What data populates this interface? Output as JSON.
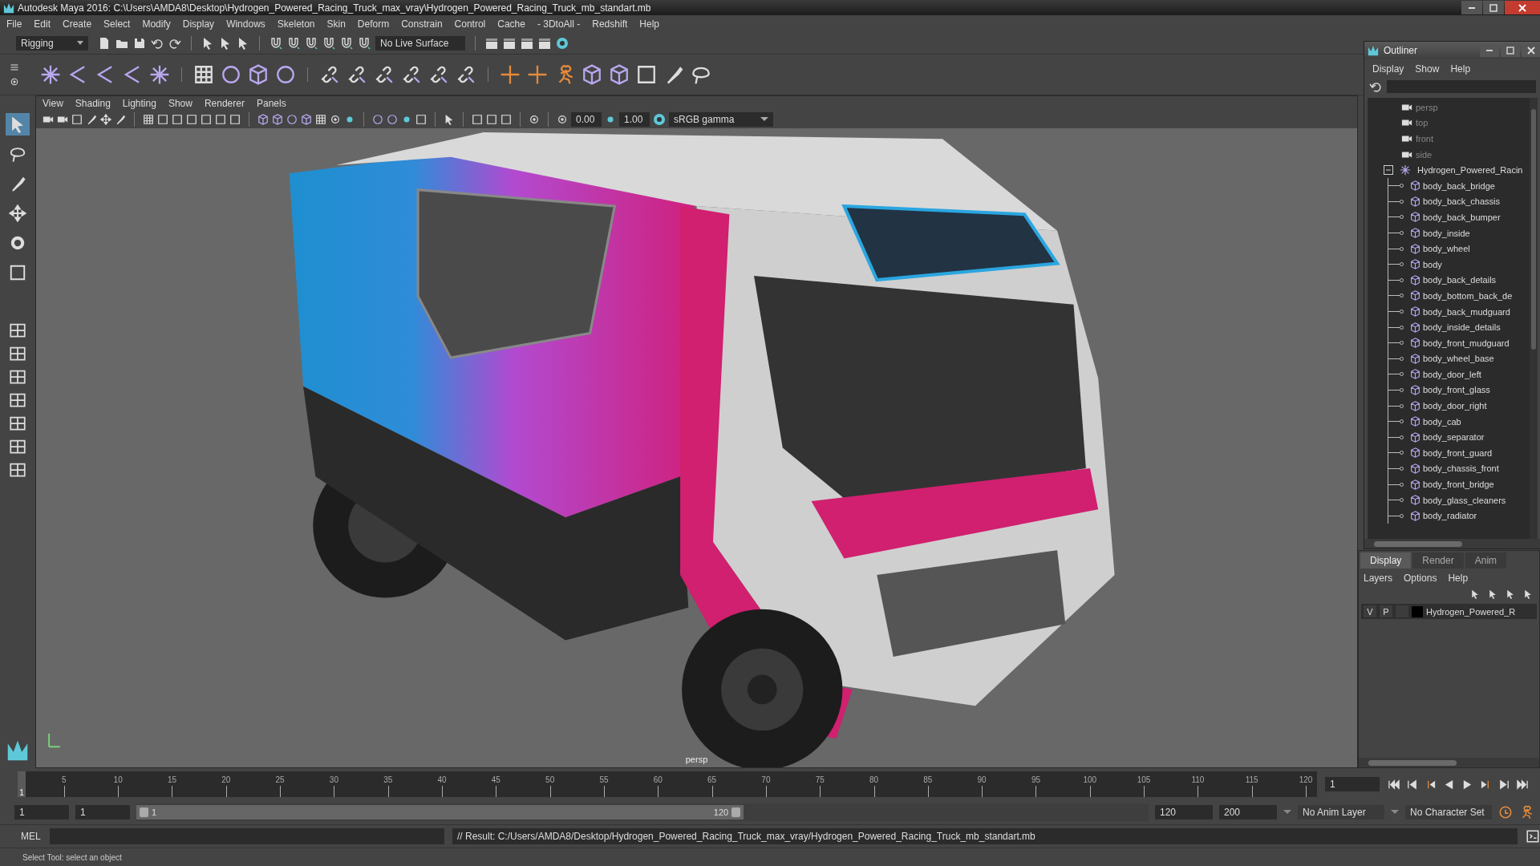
{
  "window": {
    "title": "Autodesk Maya 2016: C:\\Users\\AMDA8\\Desktop\\Hydrogen_Powered_Racing_Truck_max_vray\\Hydrogen_Powered_Racing_Truck_mb_standart.mb"
  },
  "menu_bar": [
    "File",
    "Edit",
    "Create",
    "Select",
    "Modify",
    "Display",
    "Windows",
    "Skeleton",
    "Skin",
    "Deform",
    "Constrain",
    "Control",
    "Cache",
    "- 3DtoAll -",
    "Redshift",
    "Help"
  ],
  "status_line": {
    "menu_set": "Rigging",
    "live_surface": "No Live Surface"
  },
  "viewport": {
    "menus": [
      "View",
      "Shading",
      "Lighting",
      "Show",
      "Renderer",
      "Panels"
    ],
    "exposure": "0.00",
    "gamma": "1.00",
    "color_space": "sRGB gamma",
    "camera_label": "persp"
  },
  "outliner": {
    "title": "Outliner",
    "menus": [
      "Display",
      "Show",
      "Help"
    ],
    "cameras": [
      {
        "name": "persp",
        "hidden": true
      },
      {
        "name": "top",
        "hidden": true
      },
      {
        "name": "front",
        "hidden": true
      },
      {
        "name": "side",
        "hidden": true
      }
    ],
    "group": {
      "name": "Hydrogen_Powered_Racin",
      "expanded": true,
      "children": [
        {
          "name": "body_back_bridge"
        },
        {
          "name": "body_back_chassis"
        },
        {
          "name": "body_back_bumper"
        },
        {
          "name": "body_inside"
        },
        {
          "name": "body_wheel"
        },
        {
          "name": "body"
        },
        {
          "name": "body_back_details"
        },
        {
          "name": "body_bottom_back_de"
        },
        {
          "name": "body_back_mudguard"
        },
        {
          "name": "body_inside_details"
        },
        {
          "name": "body_front_mudguard"
        },
        {
          "name": "body_wheel_base"
        },
        {
          "name": "body_door_left"
        },
        {
          "name": "body_front_glass"
        },
        {
          "name": "body_door_right"
        },
        {
          "name": "body_cab"
        },
        {
          "name": "body_separator"
        },
        {
          "name": "body_front_guard"
        },
        {
          "name": "body_chassis_front"
        },
        {
          "name": "body_front_bridge"
        },
        {
          "name": "body_glass_cleaners"
        },
        {
          "name": "body_radiator"
        }
      ]
    }
  },
  "layer_editor": {
    "tabs": [
      {
        "label": "Display",
        "selected": true
      },
      {
        "label": "Render",
        "selected": false
      },
      {
        "label": "Anim",
        "selected": false
      }
    ],
    "menus": [
      "Layers",
      "Options",
      "Help"
    ],
    "layers": [
      {
        "visibility": "V",
        "playback": "P",
        "name": "Hydrogen_Powered_R"
      }
    ]
  },
  "time_slider": {
    "current_frame": "1",
    "ticks": [
      "5",
      "10",
      "15",
      "20",
      "25",
      "30",
      "35",
      "40",
      "45",
      "50",
      "55",
      "60",
      "65",
      "70",
      "75",
      "80",
      "85",
      "90",
      "95",
      "100",
      "105",
      "110",
      "115",
      "120"
    ],
    "frame_field": "1"
  },
  "range_slider": {
    "level": 0.6,
    "start": "1",
    "playback_start": "1",
    "range_start": "1",
    "range_end": "120",
    "playback_end": "120",
    "end": "200",
    "anim_layer": "No Anim Layer",
    "character_set": "No Character Set"
  },
  "command_line": {
    "language": "MEL",
    "result": "// Result: C:/Users/AMDA8/Desktop/Hydrogen_Powered_Racing_Truck_max_vray/Hydrogen_Powered_Racing_Truck_mb_standart.mb"
  },
  "help_line": "Select Tool: select an object"
}
